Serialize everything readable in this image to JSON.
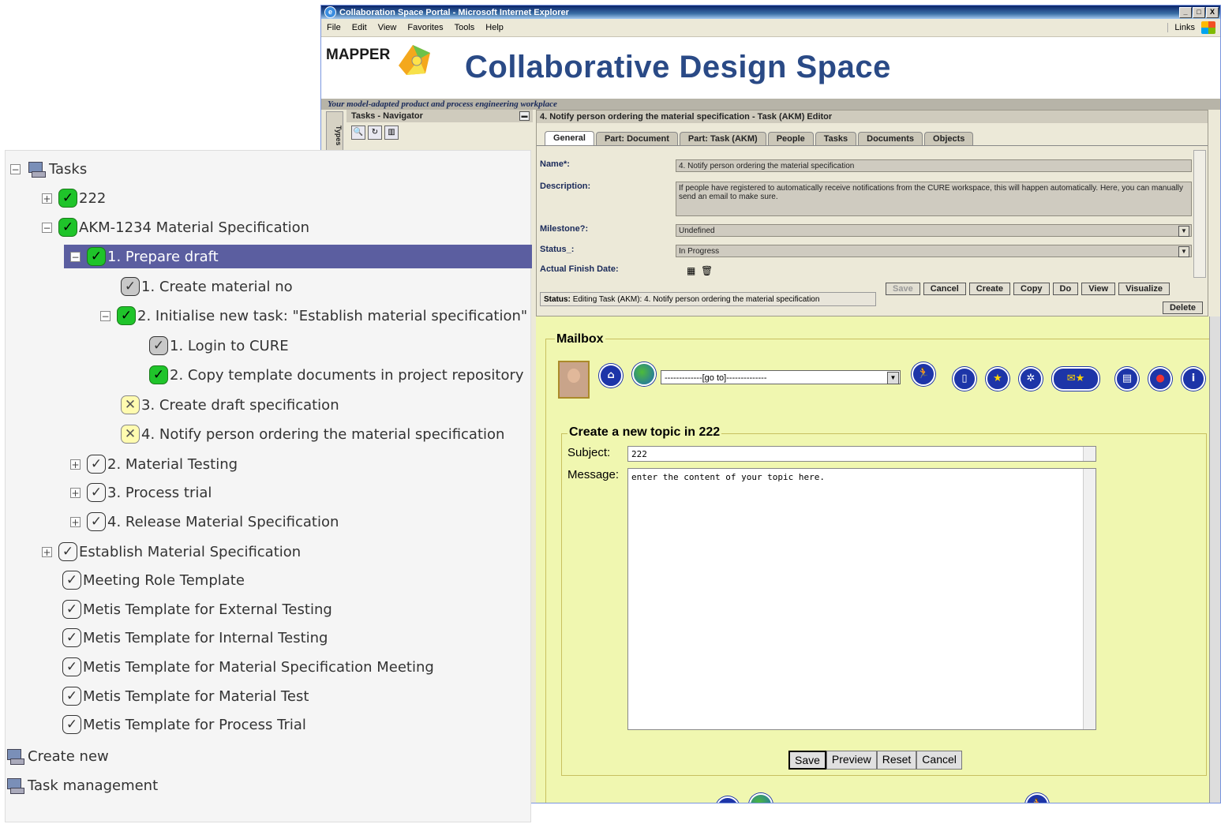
{
  "window": {
    "title": "Collaboration Space Portal - Microsoft Internet Explorer",
    "buttons": [
      "_",
      "□",
      "X"
    ]
  },
  "menu": [
    "File",
    "Edit",
    "View",
    "Favorites",
    "Tools",
    "Help"
  ],
  "links_label": "Links",
  "banner": {
    "logo_text": "MAPPER",
    "title": "Collaborative Design Space",
    "tagline": "Your model-adapted product and process engineering workplace"
  },
  "navigator": {
    "title": "Tasks - Navigator",
    "vertical_tab": "Types"
  },
  "editor": {
    "title": "4. Notify person ordering the material specification - Task (AKM) Editor",
    "tabs": [
      "General",
      "Part: Document",
      "Part: Task (AKM)",
      "People",
      "Tasks",
      "Documents",
      "Objects"
    ],
    "active_tab": "General",
    "fields": {
      "name_label": "Name*:",
      "name_value": "4. Notify person ordering the material specification",
      "description_label": "Description:",
      "description_value": "If people have registered to automatically receive notifications from the CURE workspace, this will happen automatically. Here, you can manually send an email to make sure.",
      "milestone_label": "Milestone?:",
      "milestone_value": "Undefined",
      "status_label": "Status_:",
      "status_value": "In Progress",
      "finish_label": "Actual Finish Date:"
    },
    "status_label": "Status:",
    "status_text": "Editing Task (AKM): 4. Notify person ordering the material specification",
    "actions": [
      "Save",
      "Cancel",
      "Create",
      "Copy",
      "Do",
      "View",
      "Visualize"
    ],
    "delete_label": "Delete"
  },
  "mailbox": {
    "legend": "Mailbox",
    "goto": "-------------[go to]--------------",
    "new_topic_legend": "Create a new topic in 222",
    "subject_label": "Subject:",
    "subject_value": "222",
    "message_label": "Message:",
    "message_value": "enter the content of your topic here.",
    "buttons": [
      "Save",
      "Preview",
      "Reset",
      "Cancel"
    ]
  },
  "tree": {
    "root": "Tasks",
    "items": [
      {
        "label": "222",
        "status": "green",
        "expander": "+"
      },
      {
        "label": "AKM-1234 Material Specification",
        "status": "green",
        "expander": "−"
      },
      {
        "label": "1. Prepare draft",
        "status": "green",
        "expander": "−",
        "selected": true
      },
      {
        "label": "1. Create material no",
        "status": "gray"
      },
      {
        "label": "2. Initialise new task: \"Establish material specification\"",
        "status": "green",
        "expander": "−"
      },
      {
        "label": "1. Login to CURE",
        "status": "gray"
      },
      {
        "label": "2. Copy template documents in project repository",
        "status": "green"
      },
      {
        "label": "3. Create draft specification",
        "status": "yellow"
      },
      {
        "label": "4. Notify person ordering the material specification",
        "status": "yellow"
      },
      {
        "label": "2. Material Testing",
        "status": "open",
        "expander": "+"
      },
      {
        "label": "3. Process trial",
        "status": "open",
        "expander": "+"
      },
      {
        "label": "4. Release Material Specification",
        "status": "open",
        "expander": "+"
      },
      {
        "label": "Establish Material Specification",
        "status": "open",
        "expander": "+"
      },
      {
        "label": "Meeting Role Template",
        "status": "open"
      },
      {
        "label": "Metis Template for External Testing",
        "status": "open"
      },
      {
        "label": "Metis Template for Internal Testing",
        "status": "open"
      },
      {
        "label": "Metis Template for Material Specification Meeting",
        "status": "open"
      },
      {
        "label": "Metis Template for Material Test",
        "status": "open"
      },
      {
        "label": "Metis Template for Process Trial",
        "status": "open"
      }
    ],
    "footer_items": [
      "Create new",
      "Task management"
    ]
  },
  "colors": {
    "tree_selection": "#5b5ea0",
    "status_green": "#1fc42a",
    "status_yellow": "#fffbb0",
    "mailbox_bg": "#f0f7b0",
    "title_blue": "#2a4a86"
  }
}
